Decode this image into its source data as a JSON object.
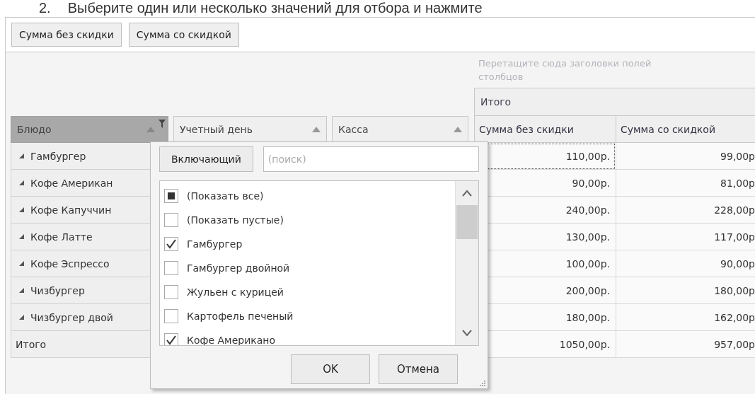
{
  "instruction": {
    "number": "2.",
    "text": "Выберите один или несколько значений для отбора и нажмите"
  },
  "toolbar": {
    "buttons": [
      "Сумма без скидки",
      "Сумма со скидкой"
    ]
  },
  "pivot": {
    "column_drop_hint": "Перетащите сюда заголовки полей столбцов",
    "column_group": "Итого",
    "row_fields": [
      {
        "label": "Блюдо",
        "active": true,
        "filter": true
      },
      {
        "label": "Учетный день",
        "active": false,
        "filter": false
      },
      {
        "label": "Касса",
        "active": false,
        "filter": false
      }
    ],
    "data_columns": [
      "Сумма без скидки",
      "Сумма со скидкой"
    ],
    "rows": [
      {
        "kind": "group",
        "label": "Гамбургер",
        "focused": true,
        "values": [
          "110,00р.",
          "99,00р"
        ]
      },
      {
        "kind": "group",
        "label": "Кофе Американ",
        "focused": false,
        "values": [
          "90,00р.",
          "81,00р"
        ]
      },
      {
        "kind": "group",
        "label": "Кофе Капуччин",
        "focused": false,
        "values": [
          "240,00р.",
          "228,00р"
        ]
      },
      {
        "kind": "group",
        "label": "Кофе Латте",
        "focused": false,
        "values": [
          "130,00р.",
          "117,00р"
        ]
      },
      {
        "kind": "group",
        "label": "Кофе Эспрессо",
        "focused": false,
        "values": [
          "100,00р.",
          "90,00р"
        ]
      },
      {
        "kind": "group",
        "label": "Чизбургер",
        "focused": false,
        "values": [
          "200,00р.",
          "180,00р"
        ]
      },
      {
        "kind": "group",
        "label": "Чизбургер двой",
        "focused": false,
        "values": [
          "180,00р.",
          "162,00р"
        ]
      },
      {
        "kind": "total",
        "label": "Итого",
        "focused": false,
        "values": [
          "1050,00р.",
          "957,00р"
        ]
      }
    ]
  },
  "filter_popup": {
    "mode_button": "Включающий",
    "search": {
      "placeholder": "(поиск)"
    },
    "items": [
      {
        "label": "(Показать все)",
        "checked": false,
        "partial": true
      },
      {
        "label": "(Показать пустые)",
        "checked": false,
        "partial": false
      },
      {
        "label": "Гамбургер",
        "checked": true,
        "partial": false
      },
      {
        "label": "Гамбургер двойной",
        "checked": false,
        "partial": false
      },
      {
        "label": "Жульен с курицей",
        "checked": false,
        "partial": false
      },
      {
        "label": "Картофель печеный",
        "checked": false,
        "partial": false
      },
      {
        "label": "Кофе Американо",
        "checked": true,
        "partial": false
      }
    ],
    "ok": "OK",
    "cancel": "Отмена"
  }
}
